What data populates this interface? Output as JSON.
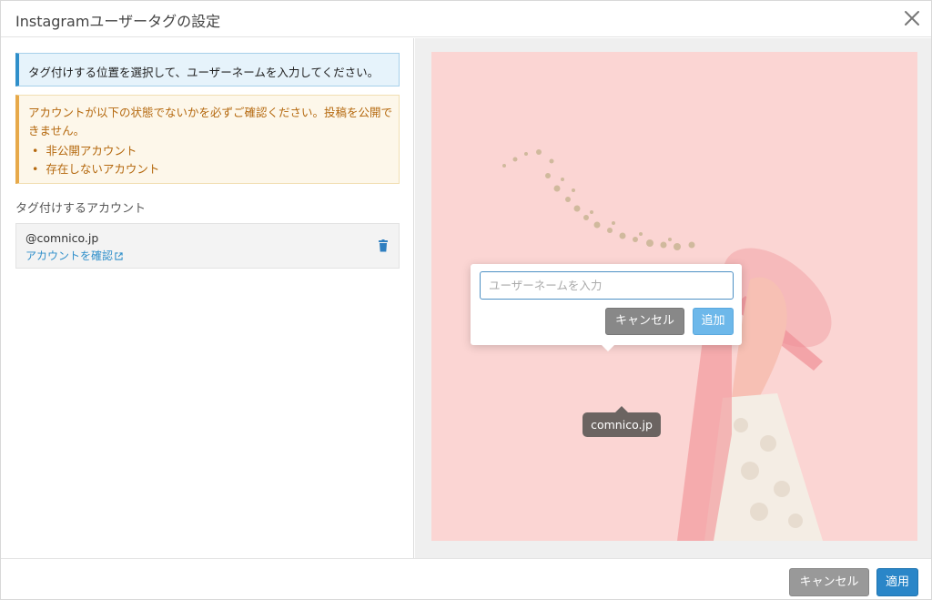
{
  "dialog": {
    "title": "Instagramユーザータグの設定"
  },
  "left": {
    "info_message": "タグ付けする位置を選択して、ユーザーネームを入力してください。",
    "warning": {
      "message": "アカウントが以下の状態でないかを必ずご確認ください。投稿を公開できません。",
      "items": [
        "非公開アカウント",
        "存在しないアカウント"
      ]
    },
    "section_label": "タグ付けするアカウント",
    "account": {
      "handle": "@comnico.jp",
      "check_link": "アカウントを確認"
    }
  },
  "tag_popup": {
    "placeholder": "ユーザーネームを入力",
    "cancel_label": "キャンセル",
    "add_label": "追加"
  },
  "photo_tag": {
    "label": "comnico.jp"
  },
  "footer": {
    "cancel_label": "キャンセル",
    "apply_label": "適用"
  },
  "colors": {
    "primary": "#2a86c8",
    "info_accent": "#2f8fca",
    "warning_accent": "#e7a94a",
    "photo_background": "#fbd5d3"
  }
}
